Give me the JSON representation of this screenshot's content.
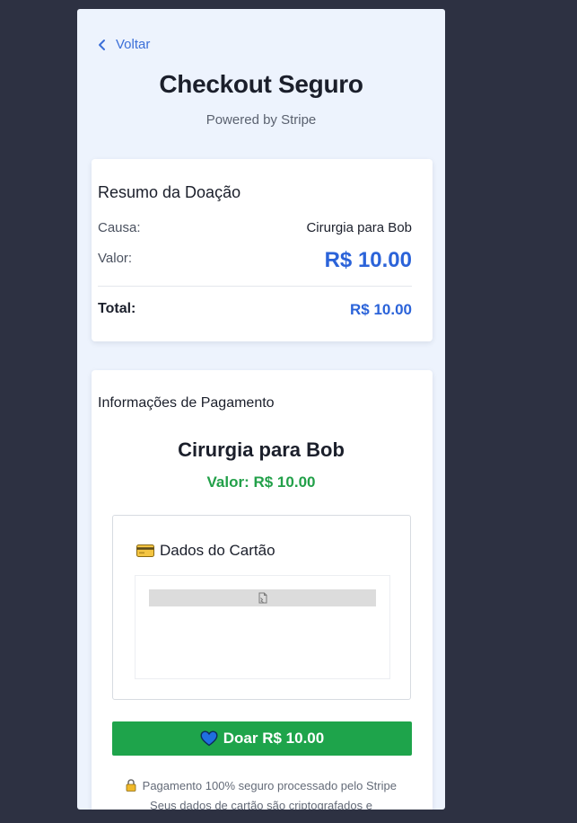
{
  "header": {
    "back_label": "Voltar",
    "title": "Checkout Seguro",
    "subtitle": "Powered by Stripe"
  },
  "summary": {
    "heading": "Resumo da Doação",
    "cause_label": "Causa:",
    "cause_value": "Cirurgia para Bob",
    "amount_label": "Valor:",
    "amount_value": "R$ 10.00",
    "total_label": "Total:",
    "total_value": "R$ 10.00"
  },
  "payment": {
    "heading": "Informações de Pagamento",
    "cause_title": "Cirurgia para Bob",
    "amount_text": "Valor: R$ 10.00",
    "card_section_title": "Dados do Cartão",
    "donate_button_label": "Doar R$ 10.00",
    "secure_note": "Pagamento 100% seguro processado pelo Stripe",
    "crypto_note": "Seus dados de cartão são criptografados e"
  },
  "icons": {
    "back": "chevron-left-icon",
    "card": "credit-card-icon",
    "stripe_frame": "broken-document-icon",
    "donate": "heart-icon",
    "secure": "lock-icon"
  },
  "colors": {
    "page_background": "#2d3142",
    "panel_background": "#edf3fd",
    "accent_blue": "#2b63d9",
    "success_green": "#1ea44b",
    "amount_green": "#22a049"
  }
}
